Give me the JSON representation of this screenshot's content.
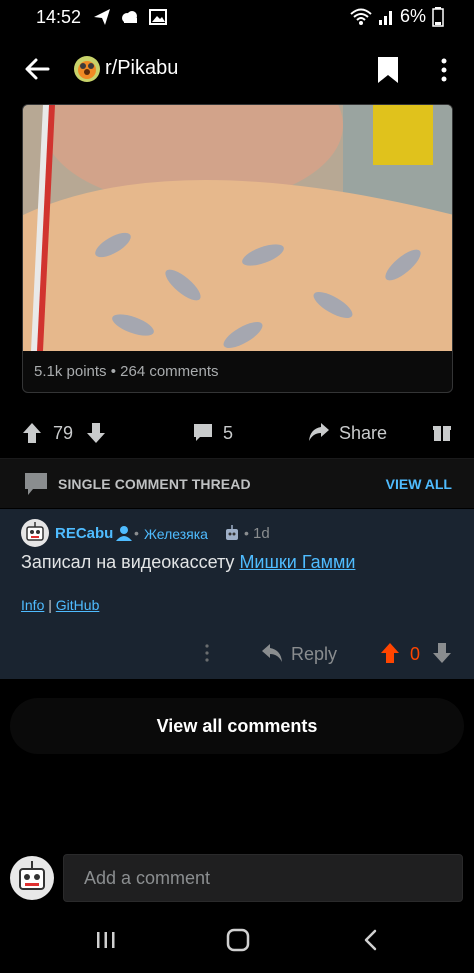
{
  "status_bar": {
    "time": "14:52",
    "battery": "6%"
  },
  "header": {
    "subreddit": "r/Pikabu"
  },
  "post": {
    "caption": "5.1k points • 264 comments",
    "vote_count": "79",
    "comment_count": "5",
    "share_label": "Share"
  },
  "thread": {
    "label": "SINGLE COMMENT THREAD",
    "view_all": "VIEW ALL"
  },
  "comment": {
    "author": "RECabu",
    "flair": "Железяка",
    "time": "1d",
    "body_prefix": "Записал на видеокассету ",
    "body_link": "Мишки Гамми",
    "link_info": "Info",
    "link_separator": " | ",
    "link_github": "GitHub",
    "reply_label": "Reply",
    "score": "0"
  },
  "view_all_comments": "View all comments",
  "composer": {
    "placeholder": "Add a comment"
  },
  "colors": {
    "accent": "#4fbcff",
    "upvote": "#ff4500",
    "comment_bg": "#1a2430"
  }
}
